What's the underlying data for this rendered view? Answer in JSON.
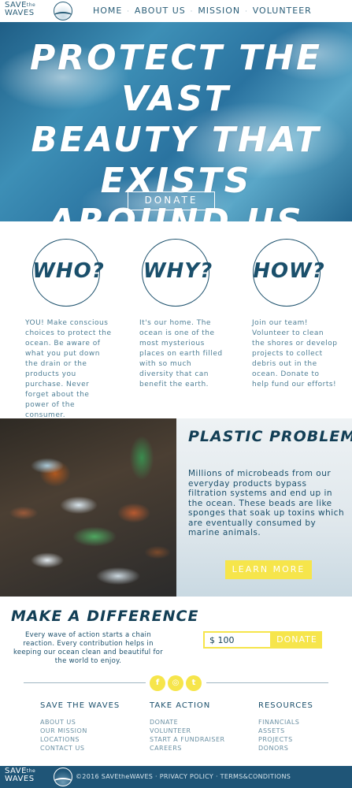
{
  "brand": {
    "line1": "SAVE",
    "the": "the",
    "line2": "WAVES"
  },
  "nav": {
    "items": [
      {
        "label": "HOME"
      },
      {
        "label": "ABOUT US"
      },
      {
        "label": "MISSION"
      },
      {
        "label": "VOLUNTEER"
      }
    ],
    "separator": "·"
  },
  "hero": {
    "title_line1": "PROTECT THE VAST",
    "title_line2": "BEAUTY THAT",
    "title_line3": "EXISTS AROUND US",
    "button": "DONATE"
  },
  "pillars": [
    {
      "word": "WHO?",
      "text": "YOU! Make conscious choices to protect the ocean. Be aware of what you put down the drain or the products you purchase. Never forget about the power of the consumer."
    },
    {
      "word": "WHY?",
      "text": "It's our home. The ocean is one of the most mysterious places on earth filled with so much diversity that can benefit the earth."
    },
    {
      "word": "HOW?",
      "text": "Join our team! Volunteer to clean the shores or develop projects to collect debris out in the ocean. Donate to help fund our efforts!"
    }
  ],
  "plastic": {
    "title": "PLASTIC PROBLEMS",
    "text": "Millions of microbeads from our everyday products bypass filtration systems and end up in the ocean. These beads are like sponges that soak up toxins which are eventually consumed by marine animals.",
    "button": "LEARN MORE"
  },
  "difference": {
    "title": "MAKE A DIFFERENCE",
    "text": "Every wave of action starts a chain reaction. Every contribution helps in keeping our ocean clean and beautiful for the world to enjoy.",
    "amount": "$ 100",
    "button": "DONATE"
  },
  "social": [
    {
      "icon": "facebook-icon",
      "glyph": "f"
    },
    {
      "icon": "instagram-icon",
      "glyph": "◎"
    },
    {
      "icon": "twitter-icon",
      "glyph": "t"
    }
  ],
  "footer": {
    "columns": [
      {
        "title": "SAVE THE WAVES",
        "items": [
          "ABOUT US",
          "OUR MISSION",
          "LOCATIONS",
          "CONTACT US"
        ]
      },
      {
        "title": "TAKE ACTION",
        "items": [
          "DONATE",
          "VOLUNTEER",
          "START A FUNDRAISER",
          "CAREERS"
        ]
      },
      {
        "title": "RESOURCES",
        "items": [
          "FINANCIALS",
          "ASSETS",
          "PROJECTS",
          "DONORS"
        ]
      }
    ],
    "copyright": "©2016 SAVEtheWAVES",
    "privacy": "PRIVACY POLICY",
    "terms": "TERMS&CONDITIONS",
    "separator": "·"
  },
  "colors": {
    "navy": "#1a4f6b",
    "yellow": "#f6e54b",
    "bottom_bar": "#1f5577"
  }
}
